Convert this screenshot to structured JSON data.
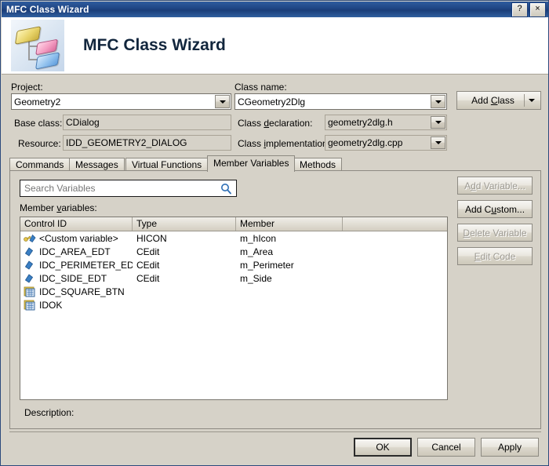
{
  "window": {
    "title": "MFC Class Wizard",
    "help_button": "?",
    "close_button": "×"
  },
  "header": {
    "title": "MFC Class Wizard",
    "icon": "class-wizard-icon"
  },
  "form": {
    "project_label": "Project:",
    "project_value": "Geometry2",
    "base_class_label": "Base class:",
    "base_class_value": "CDialog",
    "resource_label": "Resource:",
    "resource_value": "IDD_GEOMETRY2_DIALOG",
    "class_name_label": "Class name:",
    "class_name_value": "CGeometry2Dlg",
    "class_declaration_label_pre": "Class ",
    "class_declaration_label_accel": "d",
    "class_declaration_label_post": "eclaration:",
    "class_declaration_value": "geometry2dlg.h",
    "class_implementation_label_pre": "Class ",
    "class_implementation_label_accel": "i",
    "class_implementation_label_post": "mplementation:",
    "class_implementation_value": "geometry2dlg.cpp",
    "add_class_label_pre": "Add ",
    "add_class_label_accel": "C",
    "add_class_label_post": "lass"
  },
  "tabs": [
    {
      "label": "Commands",
      "active": false
    },
    {
      "label": "Messages",
      "active": false
    },
    {
      "label": "Virtual Functions",
      "active": false
    },
    {
      "label": "Member Variables",
      "active": true
    },
    {
      "label": "Methods",
      "active": false
    }
  ],
  "search": {
    "placeholder": "Search Variables",
    "value": "",
    "icon": "search-icon"
  },
  "list": {
    "label_pre": "Member ",
    "label_accel": "v",
    "label_post": "ariables:",
    "columns": [
      "Control ID",
      "Type",
      "Member",
      ""
    ],
    "rows": [
      {
        "icon": "custom-variable-icon",
        "control_id": "<Custom variable>",
        "type": "HICON",
        "member": "m_hIcon"
      },
      {
        "icon": "member-variable-icon",
        "control_id": "IDC_AREA_EDT",
        "type": "CEdit",
        "member": "m_Area"
      },
      {
        "icon": "member-variable-icon",
        "control_id": "IDC_PERIMETER_EDT",
        "type": "CEdit",
        "member": "m_Perimeter"
      },
      {
        "icon": "member-variable-icon",
        "control_id": "IDC_SIDE_EDT",
        "type": "CEdit",
        "member": "m_Side"
      },
      {
        "icon": "control-icon",
        "control_id": "IDC_SQUARE_BTN",
        "type": "",
        "member": ""
      },
      {
        "icon": "control-icon",
        "control_id": "IDOK",
        "type": "",
        "member": ""
      }
    ]
  },
  "side_buttons": {
    "add_variable_pre": "A",
    "add_variable_accel": "d",
    "add_variable_post": "d Variable...",
    "add_variable_enabled": false,
    "add_custom_pre": "Add C",
    "add_custom_accel": "u",
    "add_custom_post": "stom...",
    "add_custom_enabled": true,
    "delete_variable_accel": "D",
    "delete_variable_post": "elete Variable",
    "delete_variable_enabled": false,
    "edit_code_accel": "E",
    "edit_code_post": "dit Code",
    "edit_code_enabled": false
  },
  "description": {
    "label": "Description:",
    "value": ""
  },
  "dialog_buttons": {
    "ok": "OK",
    "cancel": "Cancel",
    "apply": "Apply"
  },
  "colors": {
    "titlebar": "#1f4583",
    "dialog_face": "#d6d2c8",
    "accent_blue": "#2f6fb5",
    "field_bg": "#ffffff"
  }
}
